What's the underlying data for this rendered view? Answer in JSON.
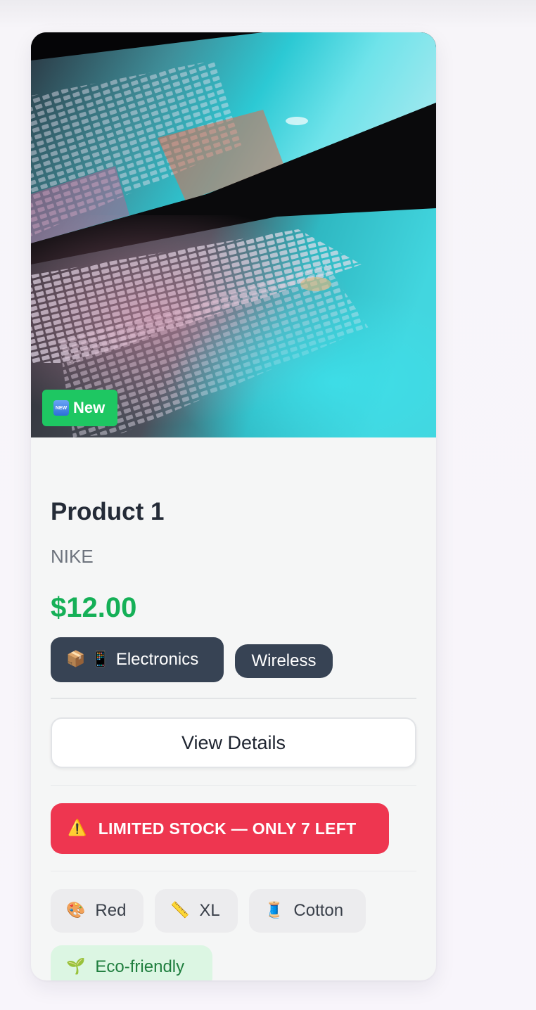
{
  "product": {
    "badge": "New",
    "badge_icon": "new-icon",
    "badge_icon_text": "NEW",
    "title": "Product 1",
    "brand": "NIKE",
    "price": "$12.00",
    "category": {
      "icons": [
        "📦",
        "📱"
      ],
      "label": "Electronics"
    },
    "tag": "Wireless",
    "details_button": "View Details",
    "stock_warning": {
      "icon": "⚠️",
      "text": "LIMITED STOCK — ONLY 7 LEFT"
    },
    "attributes": [
      {
        "icon": "🎨",
        "label": "Red"
      },
      {
        "icon": "📏",
        "label": "XL"
      },
      {
        "icon": "🧵",
        "label": "Cotton"
      },
      {
        "icon": "🌱",
        "label": "Eco-friendly"
      }
    ]
  },
  "colors": {
    "price": "#15b057",
    "badge_new": "#1ec762",
    "tag_bg": "#374354",
    "stock_bg": "#ee3650",
    "eco_bg": "#dcf6e3",
    "eco_text": "#1f7e3e"
  }
}
